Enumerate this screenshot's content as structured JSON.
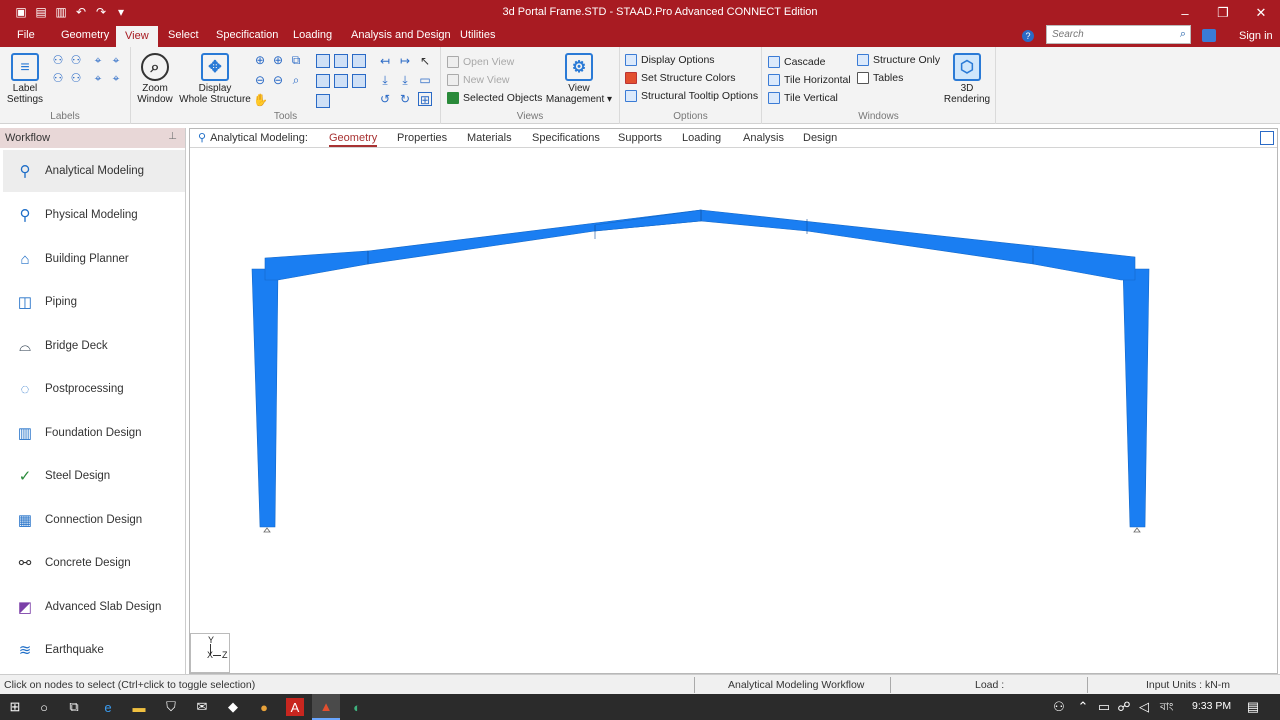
{
  "window": {
    "title": "3d Portal Frame.STD - STAAD.Pro Advanced CONNECT Edition"
  },
  "menu": {
    "tabs": [
      "File",
      "Geometry",
      "View",
      "Select",
      "Specification",
      "Loading",
      "Analysis and Design",
      "Utilities"
    ],
    "active": "View",
    "search_placeholder": "Search",
    "sign_in": "Sign in"
  },
  "ribbon": {
    "labels_group": {
      "label_settings": "Label\nSettings",
      "caption": "Labels"
    },
    "tools_group": {
      "zoom_window": "Zoom\nWindow",
      "display_whole": "Display\nWhole Structure",
      "caption": "Tools"
    },
    "views_group": {
      "open_view": "Open View",
      "new_view": "New View",
      "selected_objects": "Selected Objects",
      "view_management": "View\nManagement ▾",
      "caption": "Views"
    },
    "options_group": {
      "display_options": "Display Options",
      "set_colors": "Set Structure Colors",
      "tooltip_options": "Structural Tooltip Options",
      "caption": "Options"
    },
    "windows_group": {
      "cascade": "Cascade",
      "tile_h": "Tile Horizontal",
      "tile_v": "Tile Vertical",
      "structure_only": "Structure Only",
      "tables": "Tables",
      "rendering": "3D\nRendering",
      "caption": "Windows"
    }
  },
  "workflow": {
    "header": "Workflow",
    "items": [
      {
        "label": "Analytical Modeling",
        "icon": "analytical-modeling-icon",
        "active": true
      },
      {
        "label": "Physical Modeling",
        "icon": "physical-modeling-icon"
      },
      {
        "label": "Building Planner",
        "icon": "building-planner-icon"
      },
      {
        "label": "Piping",
        "icon": "piping-icon"
      },
      {
        "label": "Bridge Deck",
        "icon": "bridge-deck-icon"
      },
      {
        "label": "Postprocessing",
        "icon": "postprocessing-icon"
      },
      {
        "label": "Foundation Design",
        "icon": "foundation-design-icon"
      },
      {
        "label": "Steel Design",
        "icon": "steel-design-icon"
      },
      {
        "label": "Connection Design",
        "icon": "connection-design-icon"
      },
      {
        "label": "Concrete Design",
        "icon": "concrete-design-icon"
      },
      {
        "label": "Advanced Slab Design",
        "icon": "advanced-slab-design-icon"
      },
      {
        "label": "Earthquake",
        "icon": "earthquake-icon"
      }
    ]
  },
  "pagebar": {
    "title": "Analytical Modeling:",
    "tabs": [
      "Geometry",
      "Properties",
      "Materials",
      "Specifications",
      "Supports",
      "Loading",
      "Analysis",
      "Design"
    ],
    "active": "Geometry"
  },
  "axis": {
    "y": "Y",
    "x": "X",
    "z": "Z"
  },
  "colors": {
    "frame": "#1a7ef2",
    "titlebar": "#a81b22"
  },
  "status": {
    "hint": "Click on nodes to select (Ctrl+click to toggle selection)",
    "workflow": "Analytical Modeling Workflow",
    "load": "Load :",
    "units": "Input Units : kN-m"
  },
  "taskbar": {
    "lang": "বাং",
    "time": "9:33 PM"
  }
}
